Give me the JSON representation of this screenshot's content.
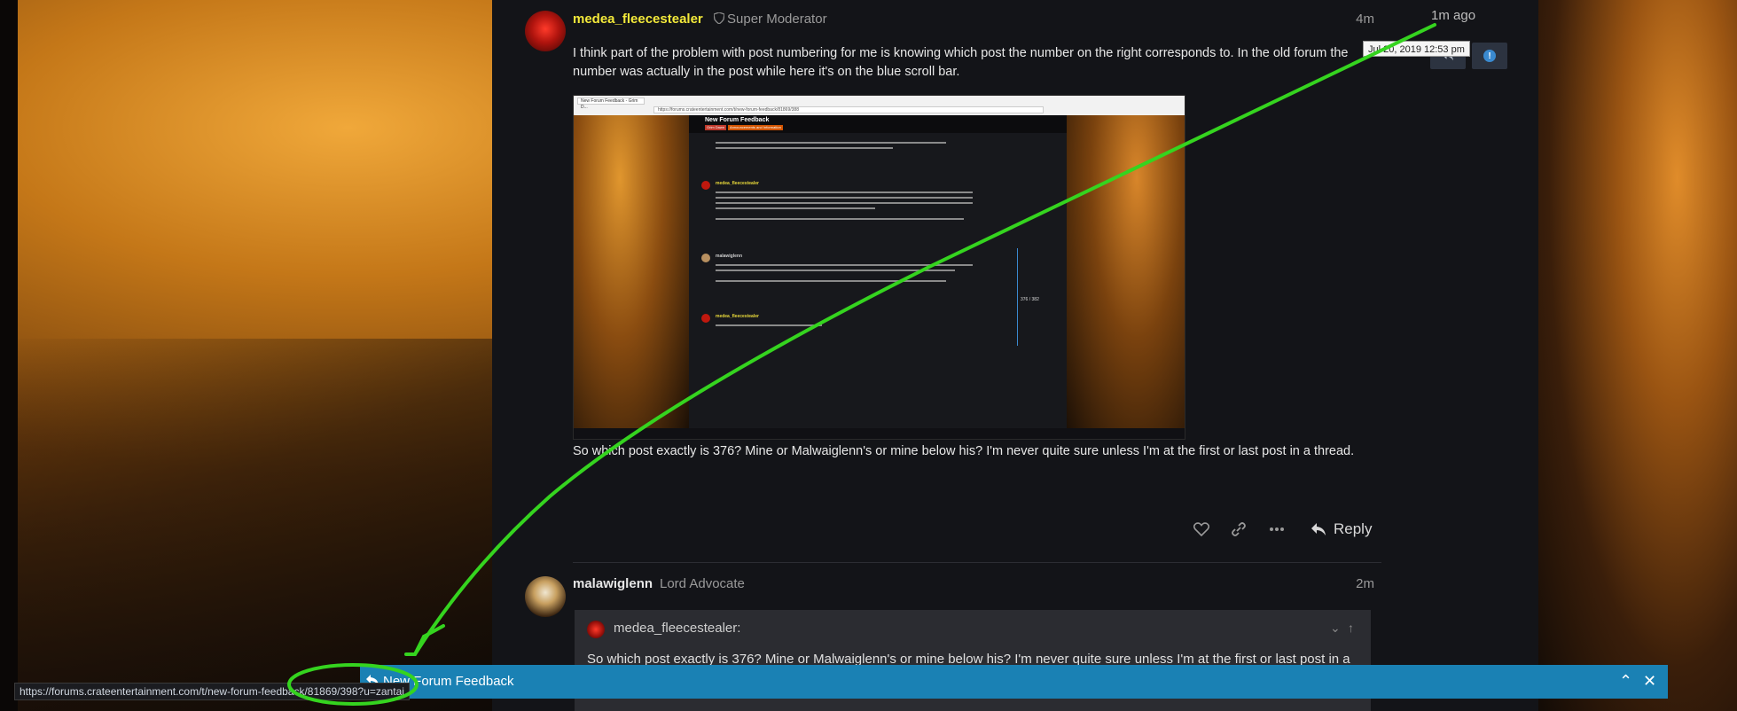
{
  "post1": {
    "username": "medea_fleecestealer",
    "role": "Super Moderator",
    "time": "4m",
    "text": "I think part of the problem with post numbering for me is knowing which post the number on the right corresponds to. In the old forum the number was actually in the post while here it's on the blue scroll bar.",
    "text_after": "So which post exactly is 376? Mine or Malwaiglenn's or mine below his? I'm never quite sure unless I'm at the first or last post in a thread.",
    "reply_label": "Reply"
  },
  "screenshot": {
    "tab_label": "New Forum Feedback - Grim D...",
    "url": "https://forums.crateentertainment.com/t/new-forum-feedback/81869/388",
    "header_title": "New Forum Feedback",
    "chip1": "Grim Dawn",
    "chip2": "Announcements and Information",
    "name1": "medea_fleecestealer",
    "name2": "malawiglenn",
    "name3": "medea_fleecestealer",
    "count": "376 / 382"
  },
  "post2": {
    "username": "malawiglenn",
    "role": "Lord Advocate",
    "time": "2m",
    "quote_user": "medea_fleecestealer:",
    "quote_text": "So which post exactly is 376? Mine or Malwaiglenn's or mine below his? I'm never quite sure unless I'm at the first or last post in a"
  },
  "timeline": {
    "top_label": "1m ago",
    "tooltip": "Jul 20, 2019 12:53 pm"
  },
  "bottom_bar": {
    "title": "New Forum Feedback"
  },
  "status_bar": {
    "url": "https://forums.crateentertainment.com/t/new-forum-feedback/81869/398?u=zantai"
  },
  "colors": {
    "username_highlight": "#f3e93a",
    "accent_blue": "#1a81b4",
    "annotation_green": "#35d41f"
  }
}
